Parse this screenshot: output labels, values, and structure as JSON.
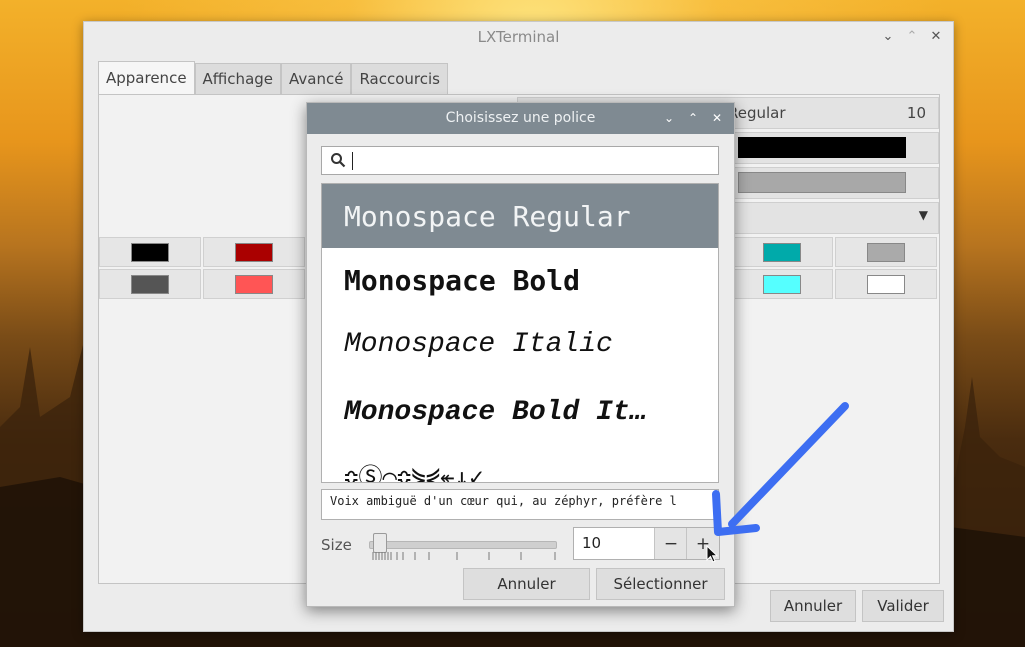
{
  "main_window": {
    "title": "LXTerminal",
    "tabs": [
      {
        "label": "Apparence",
        "active": true
      },
      {
        "label": "Affichage",
        "active": false
      },
      {
        "label": "Avancé",
        "active": false
      },
      {
        "label": "Raccourcis",
        "active": false
      }
    ],
    "font_field_partial": "Regular",
    "font_size_value": "10",
    "palette_row1": [
      "#000000",
      "#aa0000",
      "#00aaaa",
      "#aaaaaa"
    ],
    "palette_row2": [
      "#555555",
      "#ff5555",
      "#55ffff",
      "#ffffff"
    ],
    "cancel_label": "Annuler",
    "ok_label": "Valider"
  },
  "font_dialog": {
    "title": "Choisissez une police",
    "search_value": "",
    "fonts": [
      {
        "name": "Monospace Regular",
        "style": "regular",
        "selected": true
      },
      {
        "name": "Monospace Bold",
        "style": "bold",
        "selected": false
      },
      {
        "name": "Monospace Italic",
        "style": "italic",
        "selected": false
      },
      {
        "name": "Monospace Bold It…",
        "style": "bolditalic",
        "selected": false
      },
      {
        "name": "≎Ⓢ⌒≎⋟⋞↞↓✓",
        "style": "regular",
        "selected": false
      }
    ],
    "preview_text": "Voix ambiguë d'un cœur qui, au zéphyr, préfère l",
    "size_label": "Size",
    "size_value": "10",
    "minus_label": "−",
    "plus_label": "+",
    "cancel_label": "Annuler",
    "select_label": "Sélectionner"
  },
  "colors": {
    "dialog_titlebar": "#7f8a92",
    "selected_row": "#7f8a92",
    "annotation_arrow": "#3d6ef2"
  }
}
